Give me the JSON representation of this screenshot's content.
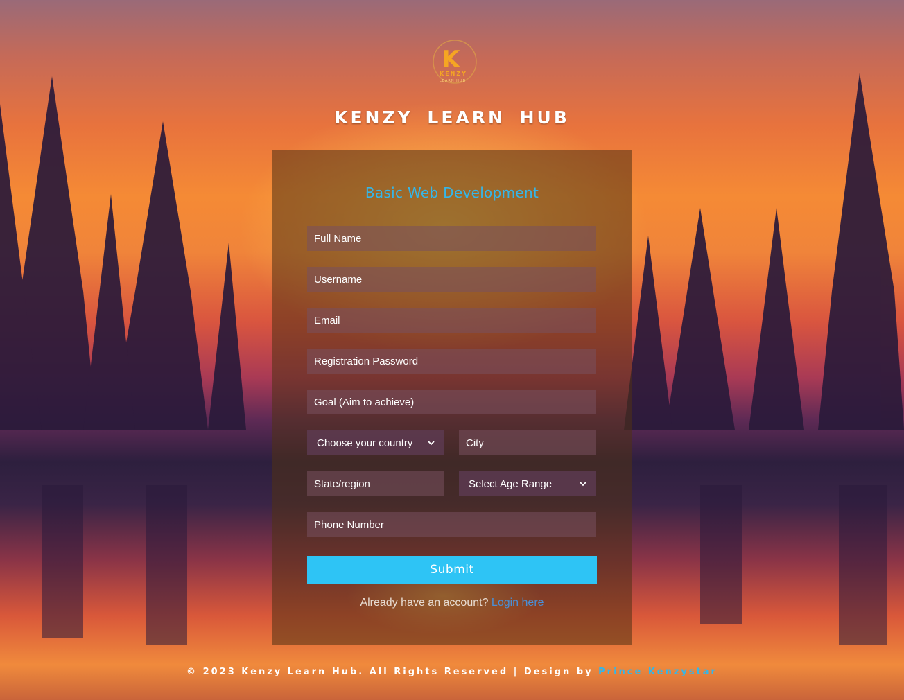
{
  "brand": {
    "logo_initial": "K",
    "logo_word": "KENZY",
    "logo_sub": "LEARN HUB",
    "title": "KENZY LEARN HUB"
  },
  "form": {
    "heading": "Basic Web Development",
    "full_name_placeholder": "Full Name",
    "username_placeholder": "Username",
    "email_placeholder": "Email",
    "password_placeholder": "Registration Password",
    "goal_placeholder": "Goal (Aim to achieve)",
    "country_select": "Choose your country",
    "city_placeholder": "City",
    "state_placeholder": "State/region",
    "age_select": "Select Age Range",
    "phone_placeholder": "Phone Number",
    "submit_label": "Submit",
    "already_text": "Already have an account?",
    "login_link": "Login here"
  },
  "footer": {
    "copyright": "© 2023 Kenzy Learn Hub. All Rights Reserved | Design by",
    "designer": "Prince Kenzystar"
  },
  "colors": {
    "accent": "#35b6e8",
    "button": "#2ec4f5",
    "link": "#4a8fd6"
  },
  "icons": {
    "select_arrow": "chevron-down-icon"
  }
}
